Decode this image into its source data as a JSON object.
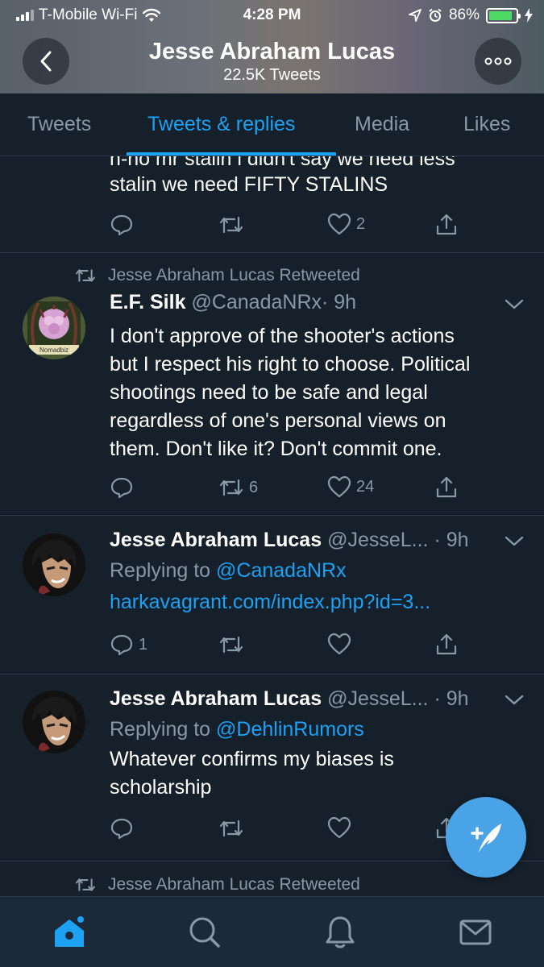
{
  "status_bar": {
    "carrier": "T-Mobile Wi-Fi",
    "time": "4:28 PM",
    "battery": "86%",
    "battery_level": 0.86,
    "battery_color": "#4cd964"
  },
  "header": {
    "title": "Jesse Abraham Lucas",
    "subtitle": "22.5K Tweets",
    "back_icon": "chevron-left-icon",
    "more_icon": "more-icon"
  },
  "tabs": [
    {
      "label": "Tweets",
      "active": false
    },
    {
      "label": "Tweets & replies",
      "active": true
    },
    {
      "label": "Media",
      "active": false
    },
    {
      "label": "Likes",
      "active": false
    }
  ],
  "tweets": [
    {
      "text_partial": "n-no mr stalin i didn't say we need less",
      "text": "stalin we need FIFTY STALINS",
      "reply_count": "",
      "retweet_count": "",
      "like_count": "2"
    },
    {
      "retweeted_by": "Jesse Abraham Lucas Retweeted",
      "name": "E.F. Silk",
      "handle": "@CanadaNRx",
      "time": "· 9h",
      "text_lines": [
        "I don't approve of the shooter's actions",
        "but I respect his right to choose. Political",
        "shootings need to be safe and legal",
        "regardless of one's personal views on",
        "them. Don't like it? Don't commit one."
      ],
      "avatar_caption": "Nomadbiz",
      "reply_count": "",
      "retweet_count": "6",
      "like_count": "24"
    },
    {
      "name": "Jesse Abraham Lucas",
      "handle": "@JesseL...",
      "time": "· 9h",
      "replying_label": "Replying to",
      "replying_to": "@CanadaNRx",
      "link": "harkavagrant.com/index.php?id=3...",
      "reply_count": "1",
      "retweet_count": "",
      "like_count": ""
    },
    {
      "name": "Jesse Abraham Lucas",
      "handle": "@JesseL...",
      "time": "· 9h",
      "replying_label": "Replying to",
      "replying_to": "@DehlinRumors",
      "text_lines": [
        "Whatever confirms my biases is",
        "scholarship"
      ],
      "reply_count": "",
      "retweet_count": "",
      "like_count": ""
    },
    {
      "retweeted_by": "Jesse Abraham Lucas Retweeted"
    }
  ],
  "bottom_nav": [
    "home-icon",
    "search-icon",
    "notifications-icon",
    "messages-icon"
  ],
  "fab_icon": "compose-tweet-icon",
  "colors": {
    "background": "#15202b",
    "accent": "#1da1f2",
    "muted": "#8899a6",
    "divider": "#2d3b48"
  }
}
